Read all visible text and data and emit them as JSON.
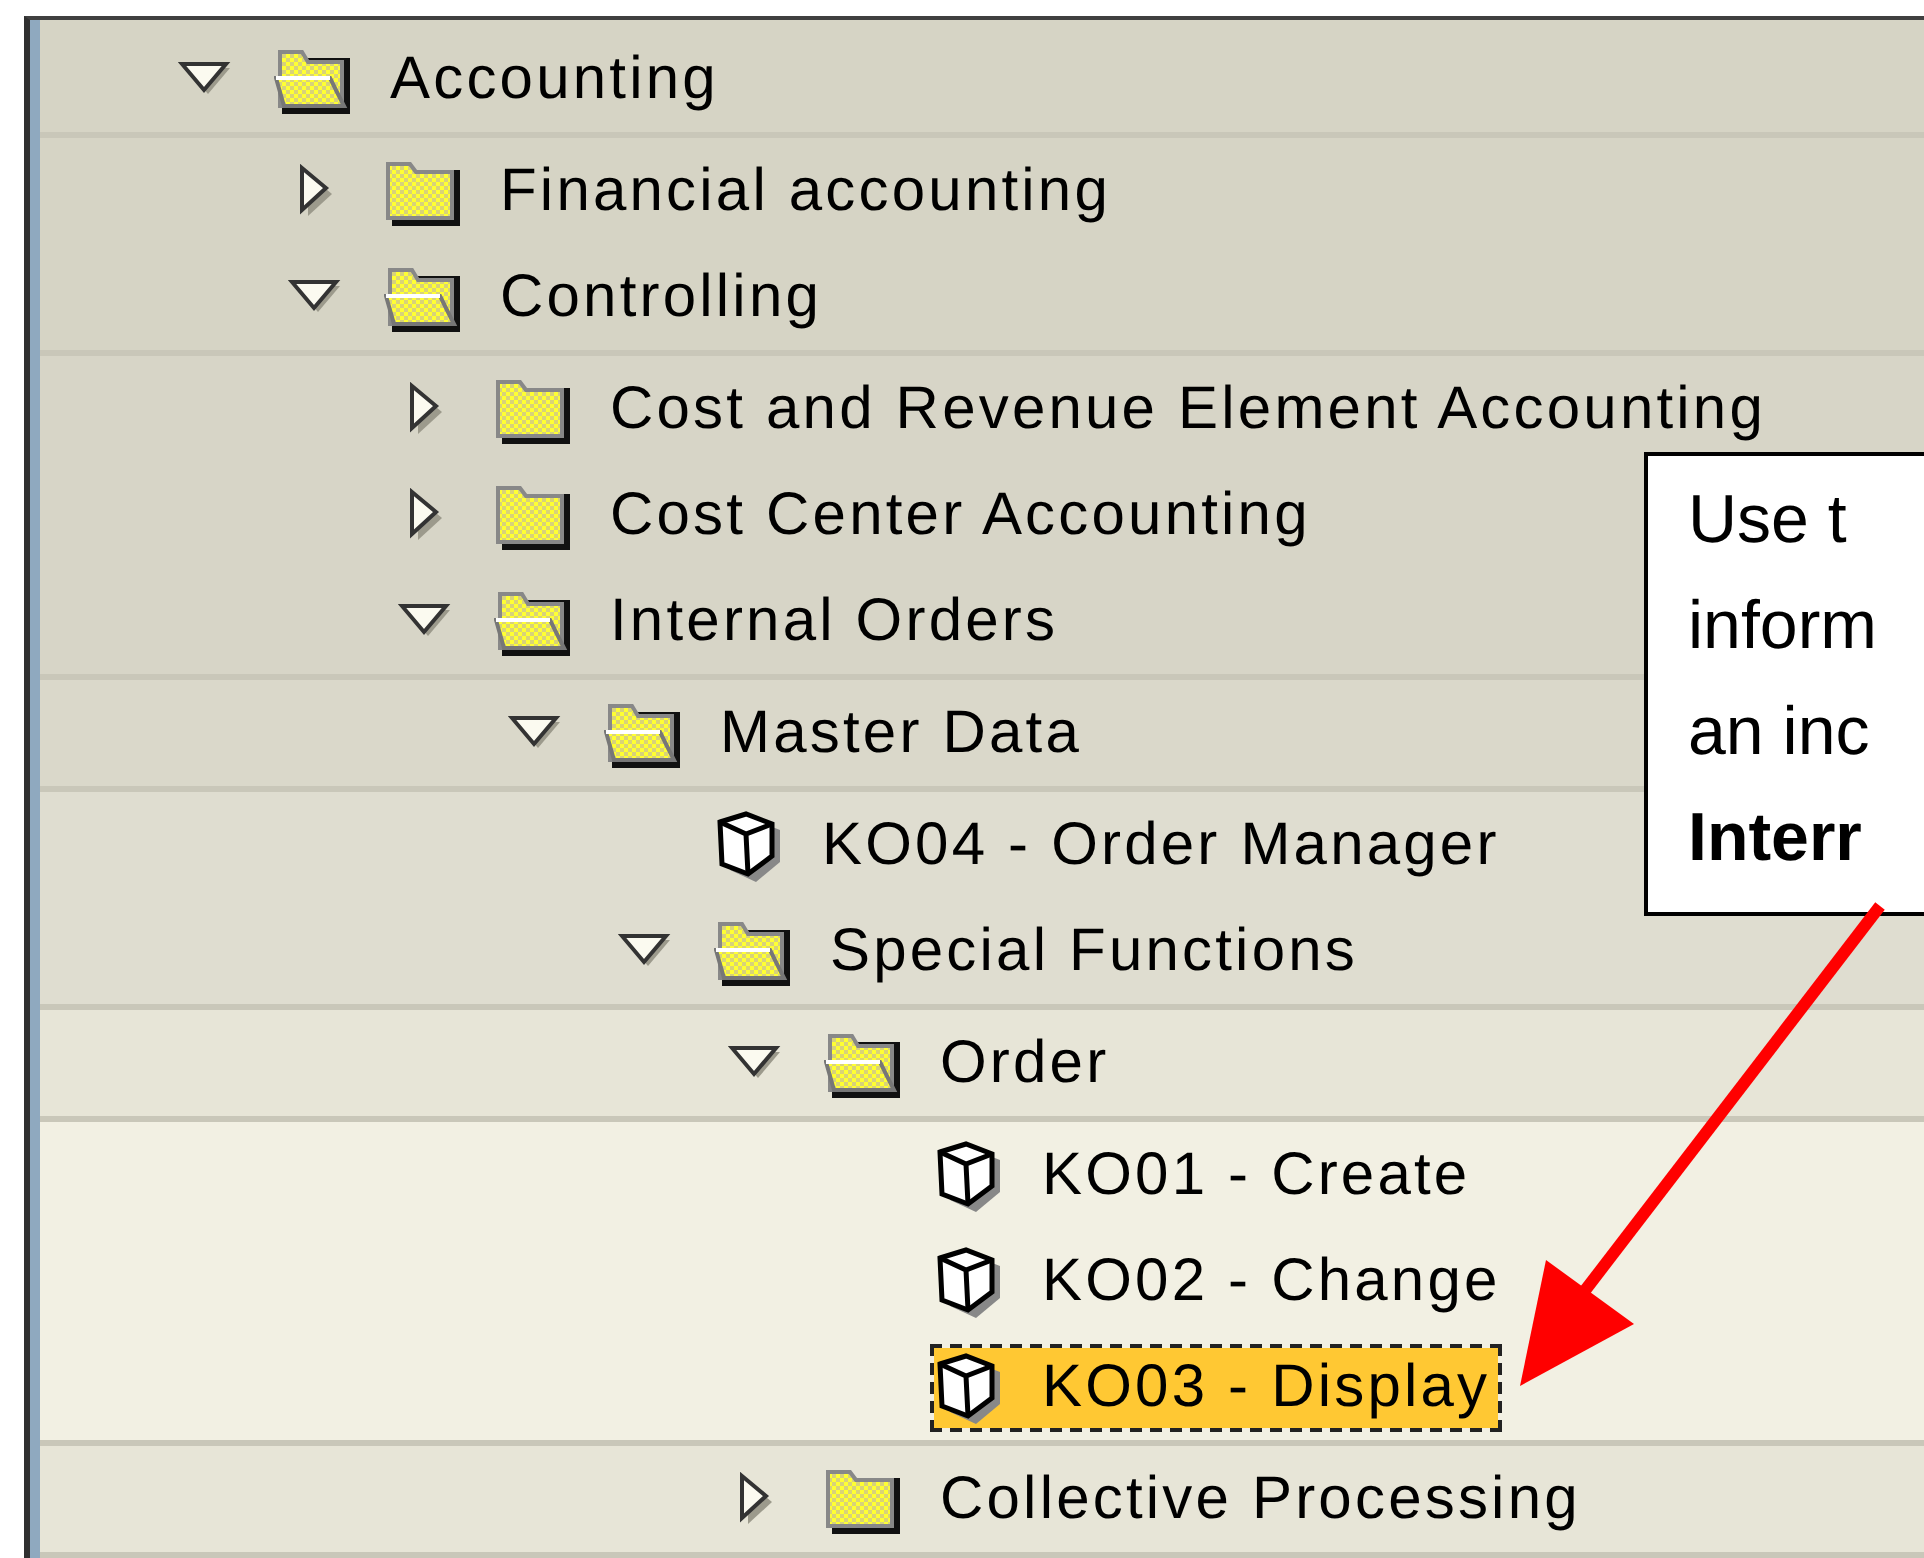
{
  "tree": [
    {
      "label": "Accounting",
      "kind": "folder",
      "expanded": true,
      "selected": false,
      "children": [
        {
          "label": "Financial accounting",
          "kind": "folder",
          "expanded": false,
          "selected": false
        },
        {
          "label": "Controlling",
          "kind": "folder",
          "expanded": true,
          "selected": false,
          "children": [
            {
              "label": "Cost and Revenue Element Accounting",
              "kind": "folder",
              "expanded": false,
              "selected": false
            },
            {
              "label": "Cost Center Accounting",
              "kind": "folder",
              "expanded": false,
              "selected": false
            },
            {
              "label": "Internal Orders",
              "kind": "folder",
              "expanded": true,
              "selected": false,
              "children": [
                {
                  "label": "Master Data",
                  "kind": "folder",
                  "expanded": true,
                  "selected": false,
                  "children": [
                    {
                      "label": "KO04 - Order Manager",
                      "kind": "transaction",
                      "selected": false
                    },
                    {
                      "label": "Special Functions",
                      "kind": "folder",
                      "expanded": true,
                      "selected": false,
                      "children": [
                        {
                          "label": "Order",
                          "kind": "folder",
                          "expanded": true,
                          "selected": false,
                          "children": [
                            {
                              "label": "KO01 - Create",
                              "kind": "transaction",
                              "selected": false
                            },
                            {
                              "label": "KO02 - Change",
                              "kind": "transaction",
                              "selected": false
                            },
                            {
                              "label": "KO03 - Display",
                              "kind": "transaction",
                              "selected": true
                            }
                          ]
                        },
                        {
                          "label": "Collective Processing",
                          "kind": "folder",
                          "expanded": false,
                          "selected": false
                        }
                      ]
                    }
                  ]
                }
              ]
            }
          ]
        }
      ]
    }
  ],
  "callout": {
    "lines": [
      {
        "text": "Use t",
        "bold": false
      },
      {
        "text": "inform",
        "bold": false
      },
      {
        "text": "an inc",
        "bold": false
      },
      {
        "text": "Interr",
        "bold": true
      }
    ]
  }
}
